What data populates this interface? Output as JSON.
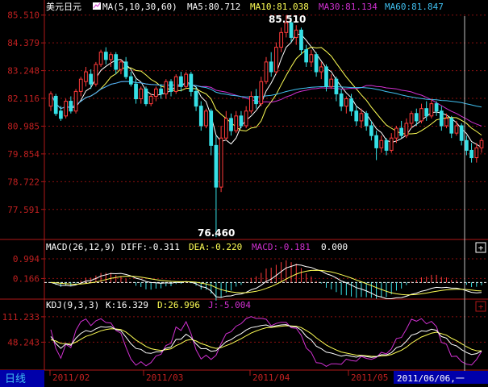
{
  "colors": {
    "background": "#000000",
    "frame": "#b01818",
    "grid": "#8a1010",
    "axis_text": "#c02020",
    "up": "#ff3b3b",
    "down": "#36e0e6",
    "ma5": "#ffffff",
    "ma10": "#ffff55",
    "ma30": "#d030d0",
    "ma60": "#40c0f0",
    "diff": "#ffffff",
    "dea": "#ffff55",
    "macd": "#d030d0",
    "k": "#ffffff",
    "d": "#ffff55",
    "j": "#d030d0",
    "period_label_bg": "#0000aa",
    "period_label_fg": "#ffffff",
    "crosshair": "#c0c0c0"
  },
  "header": {
    "symbol": "美元日元",
    "ma_label": "MA(5,10,30,60)",
    "ma5": "MA5:80.712",
    "ma10": "MA10:81.038",
    "ma30": "MA30:81.134",
    "ma60": "MA60:81.847"
  },
  "macd_header": {
    "params": "MACD(26,12,9)",
    "diff": "DIFF:-0.311",
    "dea": "DEA:-0.220",
    "macd": "MACD:-0.181",
    "extra": "0.000"
  },
  "kdj_header": {
    "params": "KDJ(9,3,3)",
    "k": "K:16.329",
    "d": "D:26.996",
    "j": "J:-5.004"
  },
  "period_label": "日线",
  "expand_icon_glyph": "+",
  "cursor_date": "2011/06/06,一",
  "annotations": {
    "high": "85.510",
    "low": "76.460"
  },
  "chart_data": [
    {
      "type": "candlestick",
      "title": "美元日元",
      "ylim": [
        76.4,
        85.6
      ],
      "y_ticks": [
        "85.510",
        "84.379",
        "83.248",
        "82.116",
        "80.985",
        "79.854",
        "78.722",
        "77.591"
      ],
      "high": 85.51,
      "low": 76.46,
      "series": [
        {
          "name": "MA5",
          "last": 80.712
        },
        {
          "name": "MA10",
          "last": 81.038
        },
        {
          "name": "MA30",
          "last": 81.134
        },
        {
          "name": "MA60",
          "last": 81.847
        }
      ],
      "candles": [
        [
          81.8,
          82.3,
          82.4,
          81.6
        ],
        [
          82.2,
          81.5,
          82.3,
          81.4
        ],
        [
          81.6,
          81.3,
          81.8,
          81.2
        ],
        [
          81.4,
          82.0,
          82.1,
          81.3
        ],
        [
          82.0,
          81.6,
          82.2,
          81.5
        ],
        [
          81.6,
          82.4,
          82.5,
          81.5
        ],
        [
          82.4,
          82.9,
          83.0,
          82.2
        ],
        [
          82.8,
          83.2,
          83.4,
          82.6
        ],
        [
          83.1,
          82.7,
          83.3,
          82.5
        ],
        [
          82.7,
          83.5,
          83.6,
          82.6
        ],
        [
          83.5,
          84.0,
          84.1,
          83.4
        ],
        [
          84.0,
          83.7,
          84.2,
          83.5
        ],
        [
          83.7,
          83.9,
          84.0,
          83.4
        ],
        [
          83.9,
          83.3,
          84.0,
          83.1
        ],
        [
          83.3,
          83.6,
          83.7,
          83.1
        ],
        [
          83.6,
          83.0,
          83.8,
          82.9
        ],
        [
          83.0,
          82.7,
          83.2,
          82.6
        ],
        [
          82.7,
          82.1,
          82.9,
          81.9
        ],
        [
          82.1,
          82.5,
          82.6,
          81.9
        ],
        [
          82.5,
          81.9,
          82.6,
          81.8
        ],
        [
          81.9,
          82.2,
          82.3,
          81.8
        ],
        [
          82.2,
          82.5,
          82.6,
          82.0
        ],
        [
          82.5,
          82.3,
          82.7,
          82.1
        ],
        [
          82.3,
          82.8,
          82.9,
          82.1
        ],
        [
          82.8,
          82.4,
          82.9,
          82.2
        ],
        [
          82.4,
          83.0,
          83.1,
          82.3
        ],
        [
          83.0,
          82.6,
          83.2,
          82.4
        ],
        [
          82.6,
          83.1,
          83.2,
          82.5
        ],
        [
          83.1,
          82.4,
          83.2,
          82.2
        ],
        [
          82.4,
          81.8,
          82.6,
          81.6
        ],
        [
          81.8,
          81.0,
          82.0,
          80.8
        ],
        [
          81.0,
          81.6,
          81.7,
          80.9
        ],
        [
          81.6,
          80.2,
          81.7,
          79.8
        ],
        [
          80.2,
          78.5,
          80.6,
          76.46
        ],
        [
          78.5,
          80.5,
          81.0,
          78.3
        ],
        [
          80.5,
          81.3,
          81.6,
          80.4
        ],
        [
          81.3,
          80.8,
          81.5,
          80.6
        ],
        [
          80.8,
          81.4,
          81.6,
          80.7
        ],
        [
          81.4,
          81.0,
          81.6,
          80.9
        ],
        [
          81.0,
          81.6,
          81.8,
          80.9
        ],
        [
          81.6,
          82.2,
          82.4,
          81.5
        ],
        [
          82.2,
          81.9,
          82.5,
          81.7
        ],
        [
          81.9,
          82.8,
          83.0,
          81.8
        ],
        [
          82.8,
          83.6,
          83.8,
          82.7
        ],
        [
          83.6,
          83.2,
          84.0,
          83.0
        ],
        [
          83.2,
          84.2,
          84.4,
          83.1
        ],
        [
          84.2,
          84.8,
          85.0,
          84.0
        ],
        [
          84.8,
          85.2,
          85.51,
          84.6
        ],
        [
          85.2,
          84.6,
          85.4,
          84.4
        ],
        [
          84.6,
          84.9,
          85.1,
          84.3
        ],
        [
          84.9,
          84.1,
          85.0,
          83.9
        ],
        [
          84.1,
          83.6,
          84.3,
          83.4
        ],
        [
          83.6,
          83.9,
          84.1,
          83.4
        ],
        [
          83.9,
          83.2,
          84.0,
          83.0
        ],
        [
          83.2,
          83.4,
          83.6,
          82.9
        ],
        [
          83.4,
          82.6,
          83.5,
          82.4
        ],
        [
          82.6,
          82.9,
          83.1,
          82.5
        ],
        [
          82.9,
          82.3,
          83.0,
          82.0
        ],
        [
          82.3,
          81.8,
          82.5,
          81.6
        ],
        [
          81.8,
          82.1,
          82.2,
          81.5
        ],
        [
          82.1,
          81.6,
          82.3,
          81.4
        ],
        [
          81.6,
          81.2,
          81.8,
          81.0
        ],
        [
          81.2,
          81.5,
          81.7,
          80.9
        ],
        [
          81.5,
          81.0,
          81.6,
          80.8
        ],
        [
          81.0,
          80.6,
          81.2,
          80.4
        ],
        [
          80.6,
          80.1,
          80.8,
          79.6
        ],
        [
          80.1,
          80.4,
          80.6,
          79.9
        ],
        [
          80.4,
          80.0,
          80.5,
          79.8
        ],
        [
          80.0,
          80.5,
          80.7,
          79.9
        ],
        [
          80.5,
          80.9,
          81.0,
          80.3
        ],
        [
          80.9,
          80.6,
          81.2,
          80.5
        ],
        [
          80.6,
          81.1,
          81.3,
          80.5
        ],
        [
          81.1,
          81.5,
          81.6,
          80.9
        ],
        [
          81.5,
          81.2,
          81.7,
          81.0
        ],
        [
          81.2,
          81.7,
          81.9,
          81.1
        ],
        [
          81.7,
          81.4,
          82.0,
          81.2
        ],
        [
          81.4,
          81.9,
          82.1,
          81.3
        ],
        [
          81.9,
          81.6,
          82.0,
          81.4
        ],
        [
          81.6,
          81.0,
          81.8,
          80.8
        ],
        [
          81.0,
          81.3,
          81.5,
          80.9
        ],
        [
          81.3,
          80.7,
          81.4,
          80.5
        ],
        [
          80.7,
          81.0,
          81.2,
          80.6
        ],
        [
          81.0,
          80.4,
          81.1,
          80.2
        ],
        [
          80.4,
          80.0,
          80.6,
          79.8
        ],
        [
          80.0,
          79.7,
          80.3,
          79.5
        ],
        [
          79.7,
          80.1,
          80.3,
          79.5
        ],
        [
          80.1,
          80.4,
          80.5,
          79.9
        ]
      ]
    },
    {
      "type": "bar",
      "title": "MACD(26,12,9)",
      "y_ticks": [
        "0.994",
        "0.166"
      ],
      "ylim": [
        -0.6,
        1.3
      ],
      "series": [
        {
          "name": "DIFF",
          "last": -0.311
        },
        {
          "name": "DEA",
          "last": -0.22
        },
        {
          "name": "MACD",
          "last": -0.181
        }
      ]
    },
    {
      "type": "line",
      "title": "KDJ(9,3,3)",
      "y_ticks": [
        "111.233",
        "48.243"
      ],
      "ylim": [
        -15,
        125
      ],
      "series": [
        {
          "name": "K",
          "last": 16.329
        },
        {
          "name": "D",
          "last": 26.996
        },
        {
          "name": "J",
          "last": -5.004
        }
      ]
    }
  ],
  "x_axis": [
    "2011/02",
    "2011/03",
    "2011/04",
    "2011/05"
  ]
}
